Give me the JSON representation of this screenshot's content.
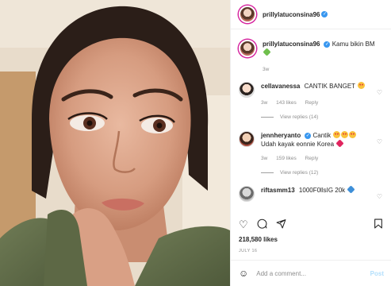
{
  "post": {
    "username": "prillylatuconsina96",
    "verified": true
  },
  "caption": {
    "username": "prillylatuconsina96",
    "text": "Kamu bikin BM",
    "emoji": "green-heart",
    "time": "3w"
  },
  "comments": [
    {
      "username": "cellavanessa",
      "text": "CANTIK BANGET",
      "emoji": "heart-eyes",
      "time": "3w",
      "likes": "143 likes",
      "reply": "Reply",
      "view_replies": "View replies (14)"
    },
    {
      "username": "jennheryanto",
      "verified": true,
      "text_line1": "Cantik",
      "text_line2": "Udah kayak eonnie Korea",
      "time": "3w",
      "likes": "159 likes",
      "reply": "Reply",
      "view_replies": "View replies (12)"
    },
    {
      "username": "riftasmm13",
      "text": "1000F0llsIG 20k",
      "emoji": "blue-heart"
    }
  ],
  "actions": {
    "like_icon": "heart-icon",
    "comment_icon": "comment-icon",
    "share_icon": "share-icon",
    "save_icon": "bookmark-icon"
  },
  "likes": "218,580 likes",
  "date": "JULY 16",
  "add_comment": {
    "placeholder": "Add a comment...",
    "post_label": "Post"
  }
}
